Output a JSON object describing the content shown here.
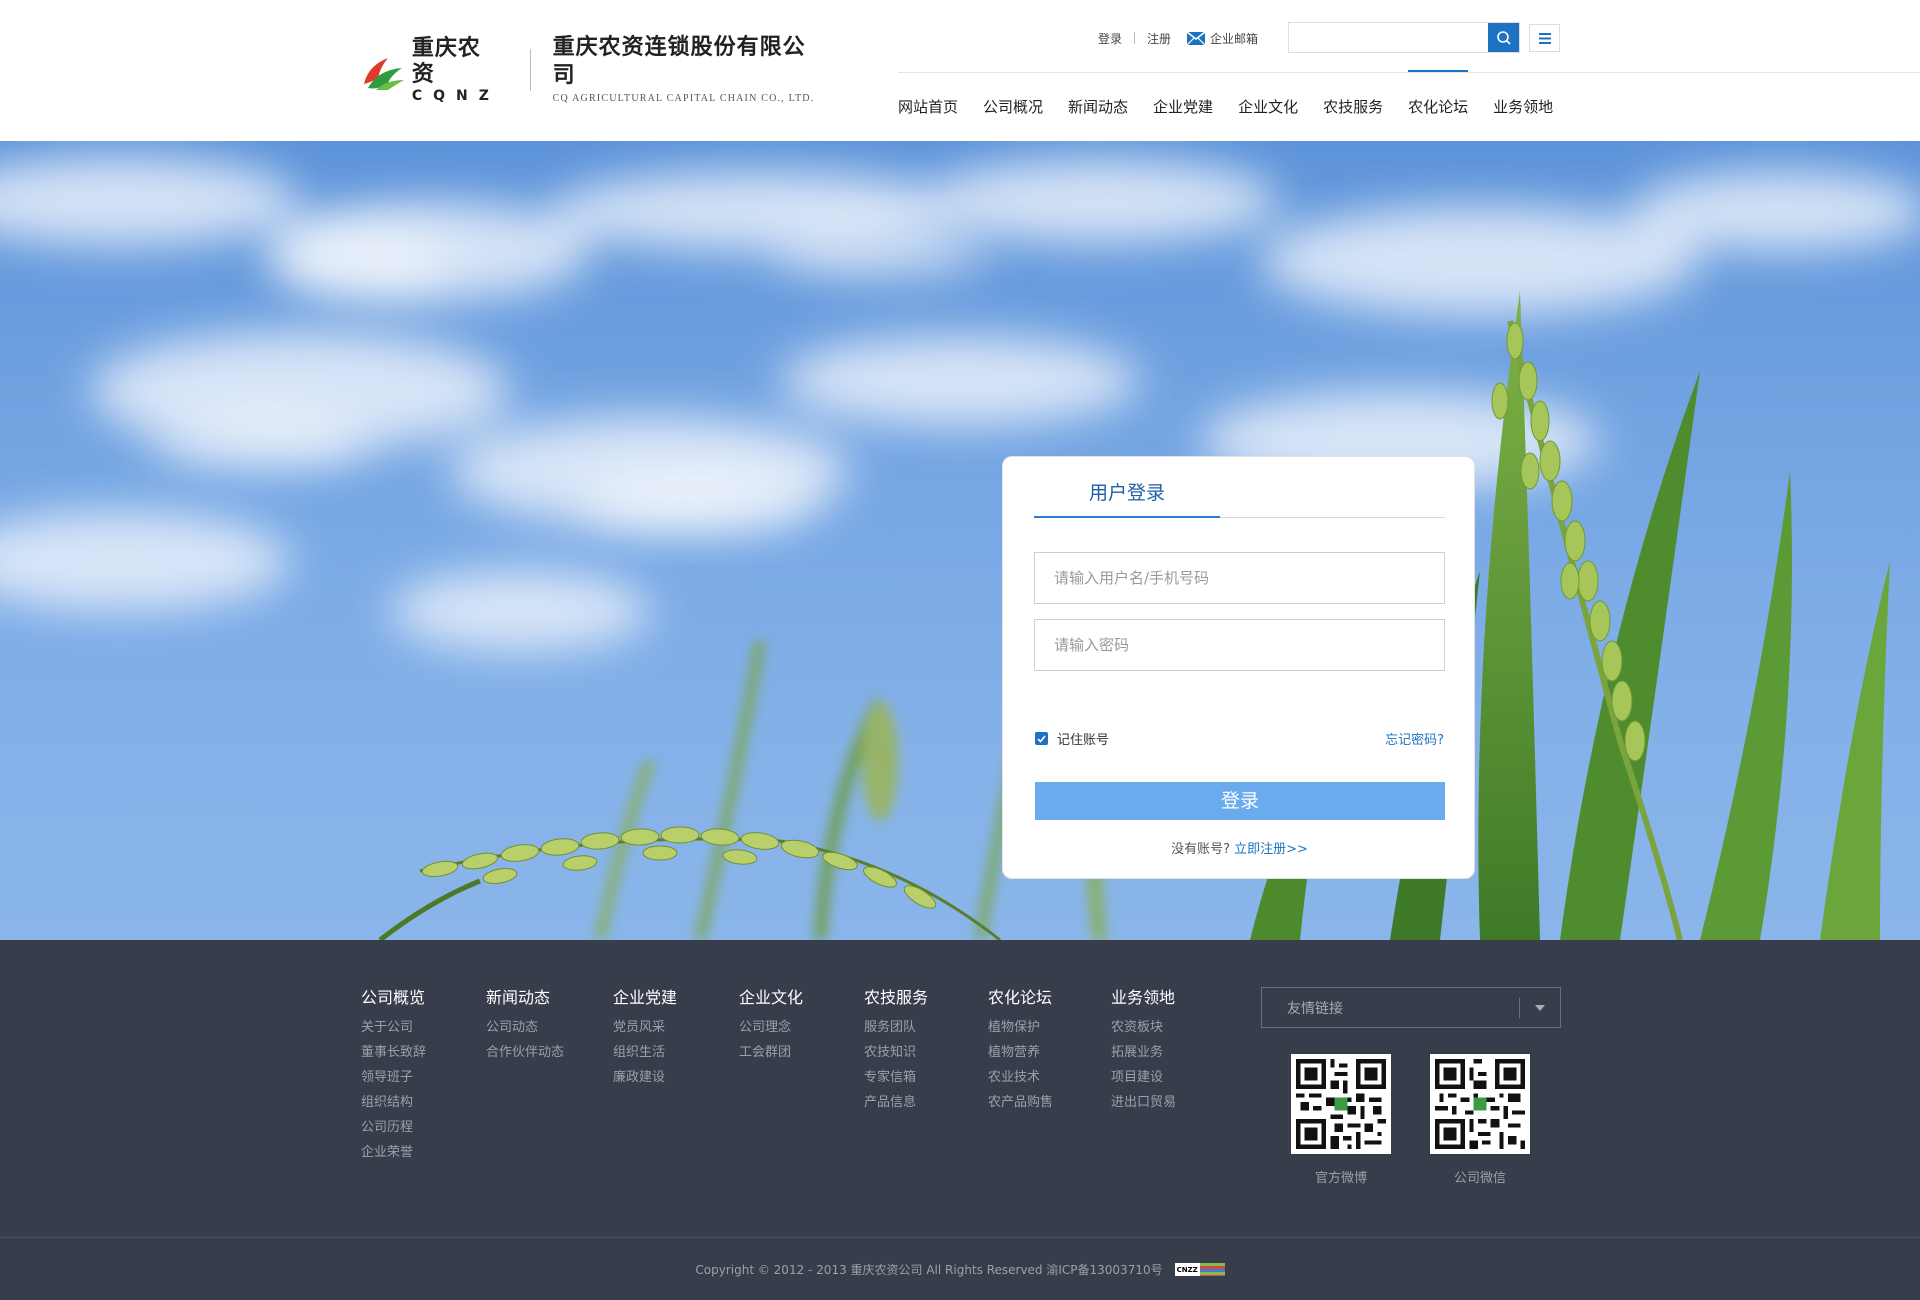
{
  "header": {
    "logo": {
      "brand_cn": "重庆农资",
      "brand_en": "CQNZ",
      "company_cn": "重庆农资连锁股份有限公司",
      "company_en": "CQ AGRICULTURAL CAPITAL CHAIN CO., LTD."
    },
    "top_links": {
      "login": "登录",
      "register": "注册",
      "mail": "企业邮箱"
    },
    "search": {
      "value": "",
      "placeholder": ""
    },
    "nav": [
      "网站首页",
      "公司概况",
      "新闻动态",
      "企业党建",
      "企业文化",
      "农技服务",
      "农化论坛",
      "业务领地"
    ],
    "nav_active": "农化论坛",
    "accent_color": "#1d73c2"
  },
  "login": {
    "tab": "用户登录",
    "username_placeholder": "请输入用户名/手机号码",
    "password_placeholder": "请输入密码",
    "remember_label": "记住账号",
    "remember_checked": true,
    "forgot": "忘记密码?",
    "submit": "登录",
    "no_account": "没有账号?",
    "register_now": "立即注册>>"
  },
  "footer": {
    "columns": [
      {
        "title": "公司概览",
        "links": [
          "关于公司",
          "董事长致辞",
          "领导班子",
          "组织结构",
          "公司历程",
          "企业荣誉"
        ]
      },
      {
        "title": "新闻动态",
        "links": [
          "公司动态",
          "合作伙伴动态"
        ]
      },
      {
        "title": "企业党建",
        "links": [
          "党员风采",
          "组织生活",
          "廉政建设"
        ]
      },
      {
        "title": "企业文化",
        "links": [
          "公司理念",
          "工会群团"
        ]
      },
      {
        "title": "农技服务",
        "links": [
          "服务团队",
          "农技知识",
          "专家信箱",
          "产品信息"
        ]
      },
      {
        "title": "农化论坛",
        "links": [
          "植物保护",
          "植物营养",
          "农业技术",
          "农产品购售"
        ]
      },
      {
        "title": "业务领地",
        "links": [
          "农资板块",
          "拓展业务",
          "项目建设",
          "进出口贸易"
        ]
      }
    ],
    "friend_links": "友情链接",
    "qr": [
      {
        "label": "官方微博"
      },
      {
        "label": "公司微信"
      }
    ],
    "copyright": "Copyright © 2012 - 2013 重庆农资公司 All Rights Reserved 渝ICP备13003710号",
    "stat_badge": "CNZZ"
  }
}
